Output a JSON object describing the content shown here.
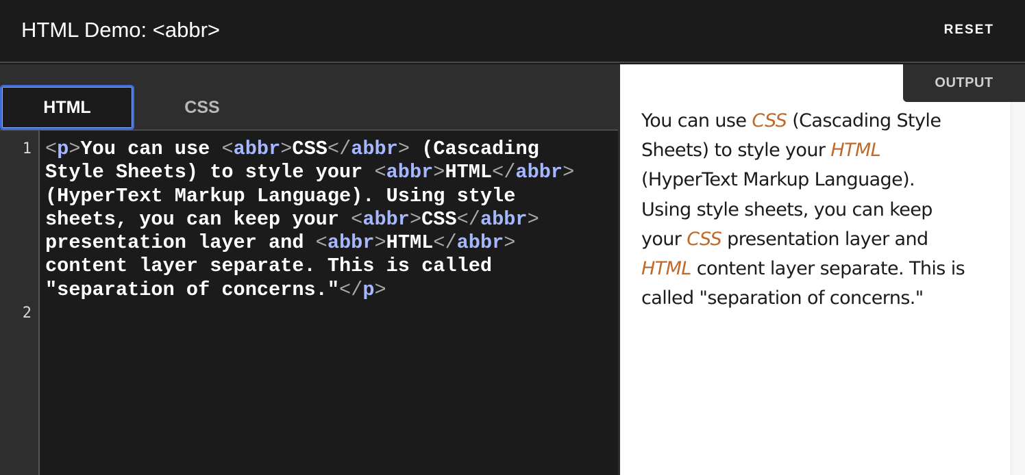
{
  "header": {
    "title": "HTML Demo: <abbr>",
    "reset_label": "RESET"
  },
  "editor": {
    "tabs": [
      {
        "label": "HTML",
        "active": true
      },
      {
        "label": "CSS",
        "active": false
      }
    ],
    "line_numbers": [
      "1",
      "2"
    ],
    "code_lines": [
      [
        {
          "t": "<",
          "c": "p"
        },
        {
          "t": "p",
          "c": "n"
        },
        {
          "t": ">",
          "c": "p"
        },
        {
          "t": "You can use ",
          "c": "x"
        },
        {
          "t": "<",
          "c": "p"
        },
        {
          "t": "abbr",
          "c": "n"
        },
        {
          "t": ">",
          "c": "p"
        },
        {
          "t": "CSS",
          "c": "x"
        },
        {
          "t": "</",
          "c": "p"
        },
        {
          "t": "abbr",
          "c": "n"
        },
        {
          "t": ">",
          "c": "p"
        },
        {
          "t": " (Cascading",
          "c": "x"
        }
      ],
      [
        {
          "t": "Style Sheets) to style your ",
          "c": "x"
        },
        {
          "t": "<",
          "c": "p"
        },
        {
          "t": "abbr",
          "c": "n"
        },
        {
          "t": ">",
          "c": "p"
        },
        {
          "t": "HTML",
          "c": "x"
        },
        {
          "t": "</",
          "c": "p"
        },
        {
          "t": "abbr",
          "c": "n"
        },
        {
          "t": ">",
          "c": "p"
        }
      ],
      [
        {
          "t": "(HyperText Markup Language). Using style",
          "c": "x"
        }
      ],
      [
        {
          "t": "sheets, you can keep your ",
          "c": "x"
        },
        {
          "t": "<",
          "c": "p"
        },
        {
          "t": "abbr",
          "c": "n"
        },
        {
          "t": ">",
          "c": "p"
        },
        {
          "t": "CSS",
          "c": "x"
        },
        {
          "t": "</",
          "c": "p"
        },
        {
          "t": "abbr",
          "c": "n"
        },
        {
          "t": ">",
          "c": "p"
        }
      ],
      [
        {
          "t": "presentation layer and ",
          "c": "x"
        },
        {
          "t": "<",
          "c": "p"
        },
        {
          "t": "abbr",
          "c": "n"
        },
        {
          "t": ">",
          "c": "p"
        },
        {
          "t": "HTML",
          "c": "x"
        },
        {
          "t": "</",
          "c": "p"
        },
        {
          "t": "abbr",
          "c": "n"
        },
        {
          "t": ">",
          "c": "p"
        }
      ],
      [
        {
          "t": "content layer separate. This is called",
          "c": "x"
        }
      ],
      [
        {
          "t": "\"separation of concerns.\"",
          "c": "x"
        },
        {
          "t": "</",
          "c": "p"
        },
        {
          "t": "p",
          "c": "n"
        },
        {
          "t": ">",
          "c": "p"
        }
      ]
    ]
  },
  "output": {
    "label": "OUTPUT",
    "lines": [
      [
        {
          "t": "You can use ",
          "a": false
        },
        {
          "t": "CSS",
          "a": true
        },
        {
          "t": " (Cascading Style",
          "a": false
        }
      ],
      [
        {
          "t": "Sheets) to style your ",
          "a": false
        },
        {
          "t": "HTML",
          "a": true
        }
      ],
      [
        {
          "t": "(HyperText Markup Language).",
          "a": false
        }
      ],
      [
        {
          "t": "Using style sheets, you can keep",
          "a": false
        }
      ],
      [
        {
          "t": "your ",
          "a": false
        },
        {
          "t": "CSS",
          "a": true
        },
        {
          "t": " presentation layer and",
          "a": false
        }
      ],
      [
        {
          "t": "HTML",
          "a": true
        },
        {
          "t": " content layer separate. This is",
          "a": false
        }
      ],
      [
        {
          "t": "called \"separation of concerns.\"",
          "a": false
        }
      ]
    ]
  },
  "colors": {
    "background": "#1b1b1b",
    "panel": "#2e2e2e",
    "active_tab_border": "#3f6bd6",
    "tag_name": "#a5b8ff",
    "tag_punct": "#a9a9a9",
    "abbr_text": "#bf6a2c"
  }
}
